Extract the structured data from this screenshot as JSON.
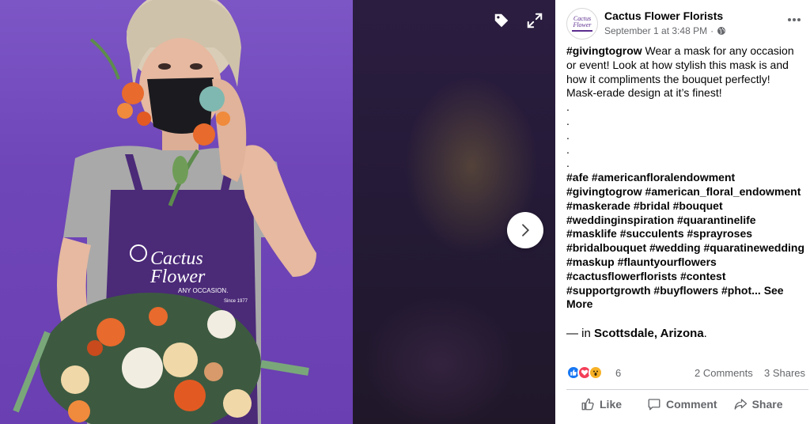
{
  "post": {
    "page_name": "Cactus Flower Florists",
    "timestamp": "September 1 at 3:48 PM",
    "meta_separator": "·",
    "avatar_text_1": "Cactus",
    "avatar_text_2": "Flower",
    "caption_lines": [
      "#givingtogrow",
      " Wear a mask for any occasion",
      "or event! Look at how stylish this mask is and",
      "how it compliments the bouquet perfectly!",
      "Mask-erade design at it’s finest!",
      ".",
      ".",
      ".",
      ".",
      ".",
      "#afe #americanfloralendowment",
      "#givingtogrow #american_floral_endowment",
      "#maskerade #bridal #bouquet",
      "#weddinginspiration #quarantinelife",
      "#masklife #succulents #sprayroses",
      "#bridalbouquet #wedding #quaratinewedding",
      "#maskup #flauntyourflowers",
      "#cactusflowerflorists #contest",
      "#supportgrowth #buyflowers #phot...",
      "See",
      "More"
    ],
    "location_prefix": "— in ",
    "location": "Scottsdale, Arizona",
    "location_suffix": ".",
    "reaction_count": "6",
    "comments": "2 Comments",
    "shares": "3 Shares",
    "actions": {
      "like": "Like",
      "comment": "Comment",
      "share": "Share"
    }
  },
  "photo": {
    "apron_brand_line1": "Cactus",
    "apron_brand_line2": "Flower",
    "apron_tagline": "ANY OCCASION.",
    "apron_since": "Since 1977"
  },
  "icons": {
    "tag": "tag-icon",
    "expand": "expand-icon",
    "next": "chevron-right-icon",
    "globe": "globe-icon",
    "more": "more-dots-icon"
  },
  "colors": {
    "background_purple": "#7d56c6",
    "apron_purple": "#4b2a78",
    "like_blue": "#1877f2",
    "love_red": "#f33e58",
    "wow_yellow": "#f7b125"
  }
}
